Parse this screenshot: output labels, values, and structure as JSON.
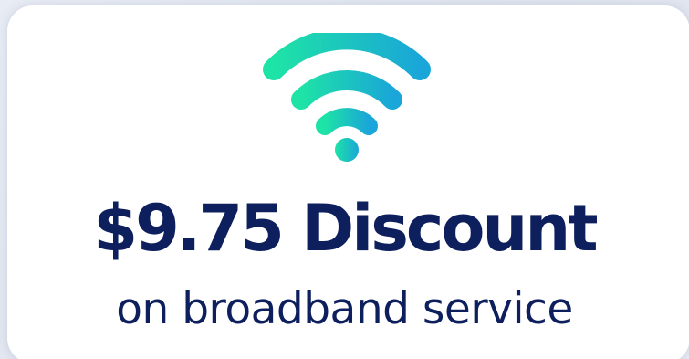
{
  "card": {
    "icon": "wifi-icon",
    "headline": "$9.75 Discount",
    "subline": "on broadband service"
  },
  "colors": {
    "text": "#0d1f5c",
    "icon_gradient_start": "#1ee3a6",
    "icon_gradient_end": "#1aa6d8",
    "card_background": "#ffffff"
  }
}
